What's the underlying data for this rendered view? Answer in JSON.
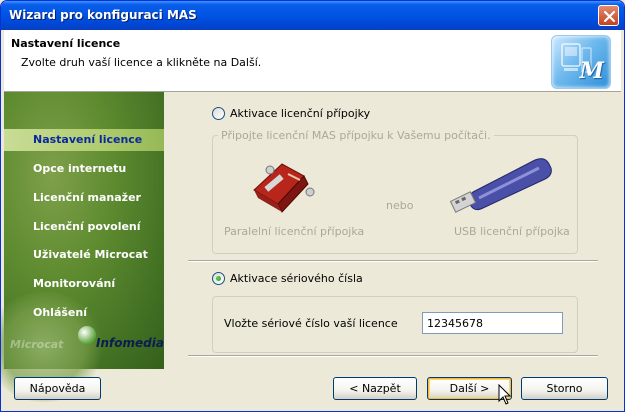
{
  "window": {
    "title": "Wizard pro konfiguraci MAS"
  },
  "header": {
    "title": "Nastavení licence",
    "subtitle": "Zvolte druh vaší licence a klikněte na Další.",
    "logo_letter": "M"
  },
  "sidebar": {
    "items": [
      {
        "label": "Nastavení licence",
        "active": true
      },
      {
        "label": "Opce internetu",
        "active": false
      },
      {
        "label": "Licenční manažer",
        "active": false
      },
      {
        "label": "Licenční povolení",
        "active": false
      },
      {
        "label": "Uživatelé Microcat",
        "active": false
      },
      {
        "label": "Monitorování",
        "active": false
      },
      {
        "label": "Ohlášení",
        "active": false
      }
    ],
    "brand": "Infomedia",
    "watermark": "Microcat"
  },
  "content": {
    "option1": {
      "label": "Aktivace licenční přípojky",
      "selected": false
    },
    "group1_caption": "Připojte licenční MAS přípojku k Vašemu počítači.",
    "parallel_label": "Paralelní licenční přípojka",
    "or_text": "nebo",
    "usb_label": "USB licenční přípojka",
    "option2": {
      "label": "Aktivace sériového čísla",
      "selected": true
    },
    "serial_label": "Vložte sériové číslo vaší licence",
    "serial_value": "12345678"
  },
  "buttons": {
    "help": "Nápověda",
    "back": "< Nazpět",
    "next": "Další >",
    "cancel": "Storno"
  },
  "colors": {
    "titlebar": "#0055e5",
    "sidebar": "#5d8a2f",
    "active_nav_text": "#0a2a9c",
    "window_bg": "#ece9d8"
  }
}
